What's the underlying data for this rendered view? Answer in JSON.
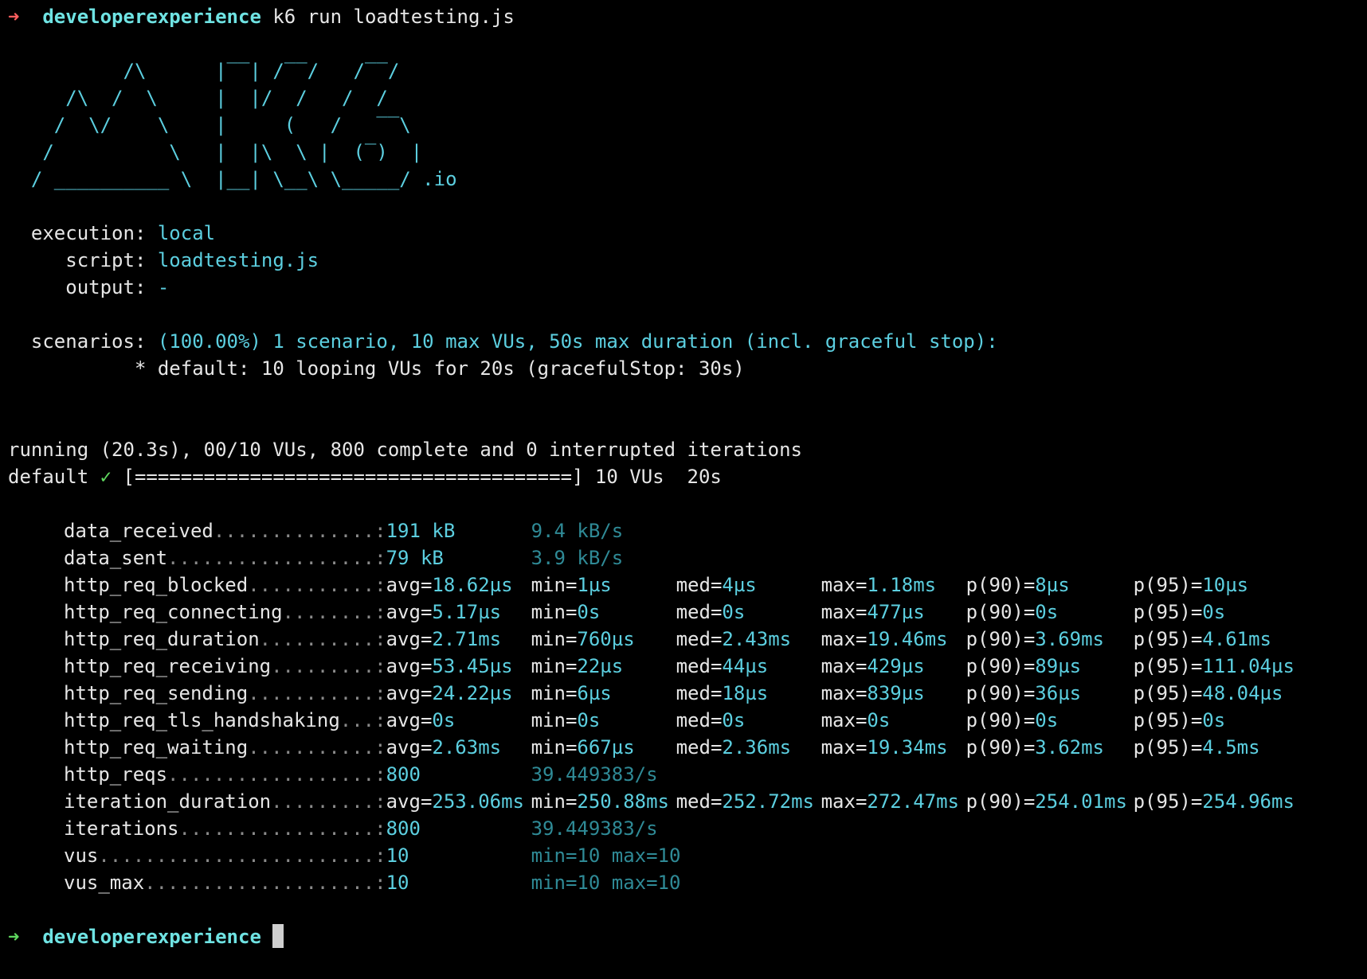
{
  "colors": {
    "background": "#000000",
    "text": "#e6e6e6",
    "cyan": "#5ccfe0",
    "dim_cyan": "#2f8a96",
    "prompt_dir": "#6fe3e3",
    "red_arrow": "#ff5f5f",
    "green_arrow": "#5fd75f"
  },
  "prompt": {
    "arrow": "➜",
    "cwd": "developerexperience",
    "command": "k6 run loadtesting.js"
  },
  "logo": [
    "          /\\      |‾‾| /‾‾/   /‾‾/   ",
    "     /\\  /  \\     |  |/  /   /  /    ",
    "    /  \\/    \\    |     (   /   ‾‾\\  ",
    "   /          \\   |  |\\  \\ |  (‾)  | ",
    "  / __________ \\  |__| \\__\\ \\_____/ .io"
  ],
  "options": {
    "execution_label": "  execution: ",
    "execution_value": "local",
    "script_label": "     script: ",
    "script_value": "loadtesting.js",
    "output_label": "     output: ",
    "output_value": "-"
  },
  "scenarios": {
    "label": "  scenarios: ",
    "value": "(100.00%) 1 scenario, 10 max VUs, 50s max duration (incl. graceful stop):",
    "detail": "           * default: 10 looping VUs for 20s (gracefulStop: 30s)"
  },
  "progress": {
    "running": "running (20.3s), 00/10 VUs, 800 complete and 0 interrupted iterations",
    "name": "default ",
    "check": "✓",
    "bar": " [======================================] 10 VUs  20s"
  },
  "metrics": [
    {
      "name": "data_received",
      "dots": "..............:",
      "cols": [
        "191 kB",
        "9.4 kB/s"
      ],
      "kind": "rate"
    },
    {
      "name": "data_sent",
      "dots": "..................:",
      "cols": [
        "79 kB",
        "3.9 kB/s"
      ],
      "kind": "rate"
    },
    {
      "name": "http_req_blocked",
      "dots": "...........:",
      "cols": [
        [
          "avg=",
          "18.62µs"
        ],
        [
          "min=",
          "1µs"
        ],
        [
          "med=",
          "4µs"
        ],
        [
          "max=",
          "1.18ms"
        ],
        [
          "p(90)=",
          "8µs"
        ],
        [
          "p(95)=",
          "10µs"
        ]
      ],
      "kind": "trend"
    },
    {
      "name": "http_req_connecting",
      "dots": "........:",
      "cols": [
        [
          "avg=",
          "5.17µs"
        ],
        [
          "min=",
          "0s"
        ],
        [
          "med=",
          "0s"
        ],
        [
          "max=",
          "477µs"
        ],
        [
          "p(90)=",
          "0s"
        ],
        [
          "p(95)=",
          "0s"
        ]
      ],
      "kind": "trend"
    },
    {
      "name": "http_req_duration",
      "dots": "..........:",
      "cols": [
        [
          "avg=",
          "2.71ms"
        ],
        [
          "min=",
          "760µs"
        ],
        [
          "med=",
          "2.43ms"
        ],
        [
          "max=",
          "19.46ms"
        ],
        [
          "p(90)=",
          "3.69ms"
        ],
        [
          "p(95)=",
          "4.61ms"
        ]
      ],
      "kind": "trend"
    },
    {
      "name": "http_req_receiving",
      "dots": ".........:",
      "cols": [
        [
          "avg=",
          "53.45µs"
        ],
        [
          "min=",
          "22µs"
        ],
        [
          "med=",
          "44µs"
        ],
        [
          "max=",
          "429µs"
        ],
        [
          "p(90)=",
          "89µs"
        ],
        [
          "p(95)=",
          "111.04µs"
        ]
      ],
      "kind": "trend"
    },
    {
      "name": "http_req_sending",
      "dots": "...........:",
      "cols": [
        [
          "avg=",
          "24.22µs"
        ],
        [
          "min=",
          "6µs"
        ],
        [
          "med=",
          "18µs"
        ],
        [
          "max=",
          "839µs"
        ],
        [
          "p(90)=",
          "36µs"
        ],
        [
          "p(95)=",
          "48.04µs"
        ]
      ],
      "kind": "trend"
    },
    {
      "name": "http_req_tls_handshaking",
      "dots": "...:",
      "cols": [
        [
          "avg=",
          "0s"
        ],
        [
          "min=",
          "0s"
        ],
        [
          "med=",
          "0s"
        ],
        [
          "max=",
          "0s"
        ],
        [
          "p(90)=",
          "0s"
        ],
        [
          "p(95)=",
          "0s"
        ]
      ],
      "kind": "trend"
    },
    {
      "name": "http_req_waiting",
      "dots": "...........:",
      "cols": [
        [
          "avg=",
          "2.63ms"
        ],
        [
          "min=",
          "667µs"
        ],
        [
          "med=",
          "2.36ms"
        ],
        [
          "max=",
          "19.34ms"
        ],
        [
          "p(90)=",
          "3.62ms"
        ],
        [
          "p(95)=",
          "4.5ms"
        ]
      ],
      "kind": "trend"
    },
    {
      "name": "http_reqs",
      "dots": "..................:",
      "cols": [
        "800",
        "39.449383/s"
      ],
      "kind": "rate"
    },
    {
      "name": "iteration_duration",
      "dots": ".........:",
      "cols": [
        [
          "avg=",
          "253.06ms"
        ],
        [
          "min=",
          "250.88ms"
        ],
        [
          "med=",
          "252.72ms"
        ],
        [
          "max=",
          "272.47ms"
        ],
        [
          "p(90)=",
          "254.01ms"
        ],
        [
          "p(95)=",
          "254.96ms"
        ]
      ],
      "kind": "trend"
    },
    {
      "name": "iterations",
      "dots": ".................:",
      "cols": [
        "800",
        "39.449383/s"
      ],
      "kind": "rate"
    },
    {
      "name": "vus",
      "dots": "........................:",
      "cols": [
        "10",
        "min=10 max=10"
      ],
      "kind": "rate"
    },
    {
      "name": "vus_max",
      "dots": "....................:",
      "cols": [
        "10",
        "min=10 max=10"
      ],
      "kind": "rate"
    }
  ],
  "final_prompt": {
    "arrow": "➜",
    "cwd": "developerexperience"
  }
}
